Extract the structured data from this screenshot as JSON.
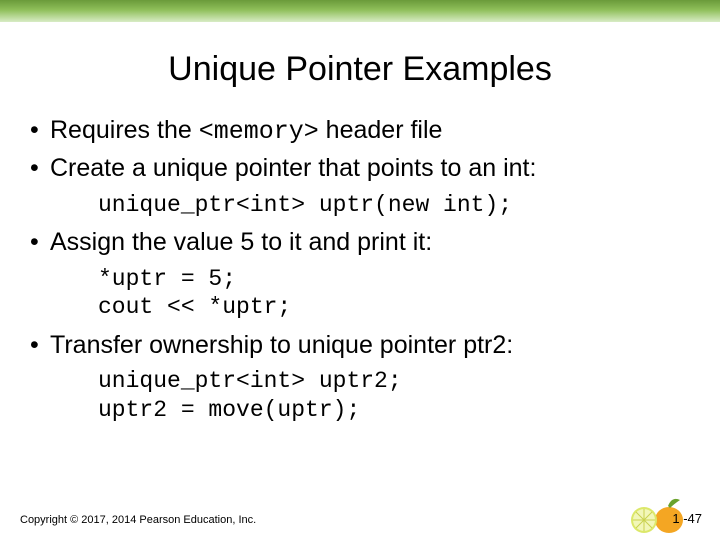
{
  "title": "Unique Pointer Examples",
  "bullets": {
    "b1_pre": "Requires the ",
    "b1_code": "<memory>",
    "b1_post": "  header file",
    "b2": "Create a unique pointer that points to an int:",
    "code2": "unique_ptr<int> uptr(new int);",
    "b3": "Assign the value 5 to it and print it:",
    "code3": "*uptr = 5;\ncout << *uptr;",
    "b4": "Transfer ownership to unique pointer ptr2:",
    "code4": "unique_ptr<int> uptr2;\nuptr2 = move(uptr);"
  },
  "footer": "Copyright © 2017, 2014 Pearson Education, Inc.",
  "pagenum": "1 -47"
}
